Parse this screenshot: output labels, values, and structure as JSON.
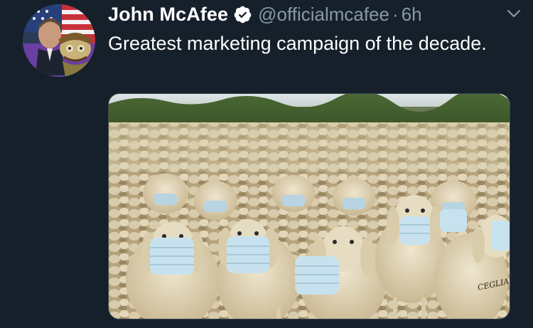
{
  "tweet": {
    "display_name": "John McAfee",
    "handle": "@officialmcafee",
    "separator": "·",
    "time": "6h",
    "text": "Greatest marketing campaign of the decade.",
    "verified": true,
    "icons": {
      "verified": "verified-badge-icon",
      "menu": "chevron-down-icon"
    },
    "media": {
      "description_kind": "photo",
      "signature": "CEGLIA"
    }
  },
  "colors": {
    "background": "#15202b",
    "primary_text": "#ffffff",
    "secondary_text": "#8899a6",
    "border": "#38444d"
  }
}
